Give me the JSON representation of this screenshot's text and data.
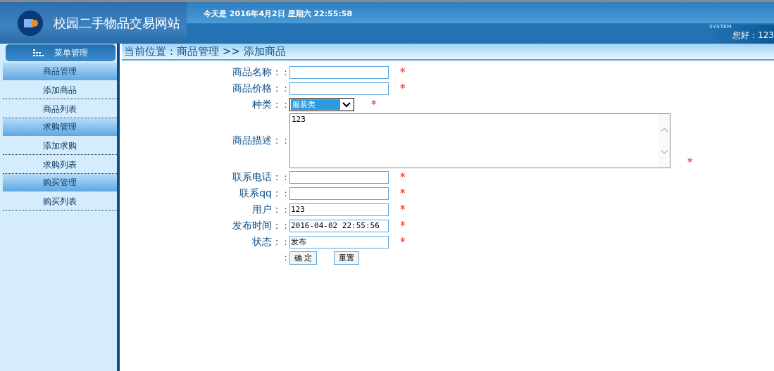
{
  "header": {
    "site_title": "校园二手物品交易网站",
    "date_line": "今天是 2016年4月2日 星期六 22:55:58",
    "badge": "SYSTEM",
    "greeting": "您好：123"
  },
  "sidebar": {
    "title": "菜单管理",
    "groups": [
      {
        "label": "商品管理",
        "items": [
          "添加商品",
          "商品列表"
        ]
      },
      {
        "label": "求购管理",
        "items": [
          "添加求购",
          "求购列表"
        ]
      },
      {
        "label": "购买管理",
        "items": [
          "购买列表"
        ]
      }
    ]
  },
  "breadcrumb": "当前位置：商品管理 >> 添加商品",
  "form": {
    "fields": [
      {
        "kind": "text",
        "label": "商品名称：",
        "colon": ":",
        "required": true
      },
      {
        "kind": "text",
        "label": "商品价格：",
        "colon": ":",
        "required": true
      },
      {
        "kind": "select",
        "label": "种类：",
        "colon": ":",
        "value": "服装类",
        "required": true
      },
      {
        "kind": "textarea",
        "label": "商品描述：",
        "colon": ":",
        "value": "123",
        "required": true
      },
      {
        "kind": "text",
        "label": "联系电话：",
        "colon": ":",
        "required": true
      },
      {
        "kind": "text",
        "label": "联系qq：",
        "colon": ":",
        "required": true
      },
      {
        "kind": "text",
        "label": "用户：",
        "colon": ":",
        "value": "123",
        "required": true
      },
      {
        "kind": "text",
        "label": "发布时间：",
        "colon": ":",
        "value": "2016-04-02 22:55:56",
        "required": true
      },
      {
        "kind": "text",
        "label": "状态：",
        "colon": ":",
        "value": "发布",
        "required": true
      }
    ],
    "required_mark": "*",
    "buttons_colon": ":",
    "buttons": [
      "确 定",
      "重置"
    ]
  }
}
